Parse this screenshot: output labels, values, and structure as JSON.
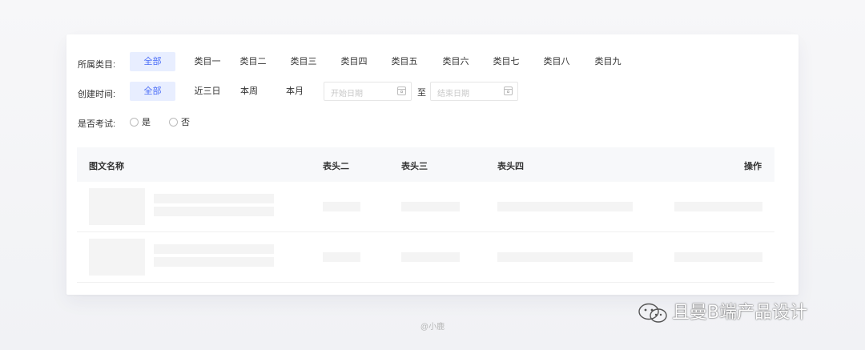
{
  "filters": {
    "category": {
      "label": "所属类目:",
      "options": [
        "全部",
        "类目一",
        "类目二",
        "类目三",
        "类目四",
        "类目五",
        "类目六",
        "类目七",
        "类目八",
        "类目九"
      ],
      "selected": "全部"
    },
    "created_time": {
      "label": "创建时间:",
      "options": [
        "全部",
        "近三日",
        "本周",
        "本月"
      ],
      "selected": "全部",
      "start_placeholder": "开始日期",
      "separator": "至",
      "end_placeholder": "结束日期"
    },
    "exam": {
      "label": "是否考试:",
      "options": [
        "是",
        "否"
      ]
    }
  },
  "table": {
    "columns": [
      "图文名称",
      "表头二",
      "表头三",
      "表头四",
      "操作"
    ]
  },
  "footer": "@小鹿",
  "watermark": "且曼B端产品设计",
  "colors": {
    "accent": "#4a6cf7",
    "accent_bg": "#e8eeff",
    "skeleton": "#f4f4f4",
    "header_bg": "#f7f8fa"
  }
}
